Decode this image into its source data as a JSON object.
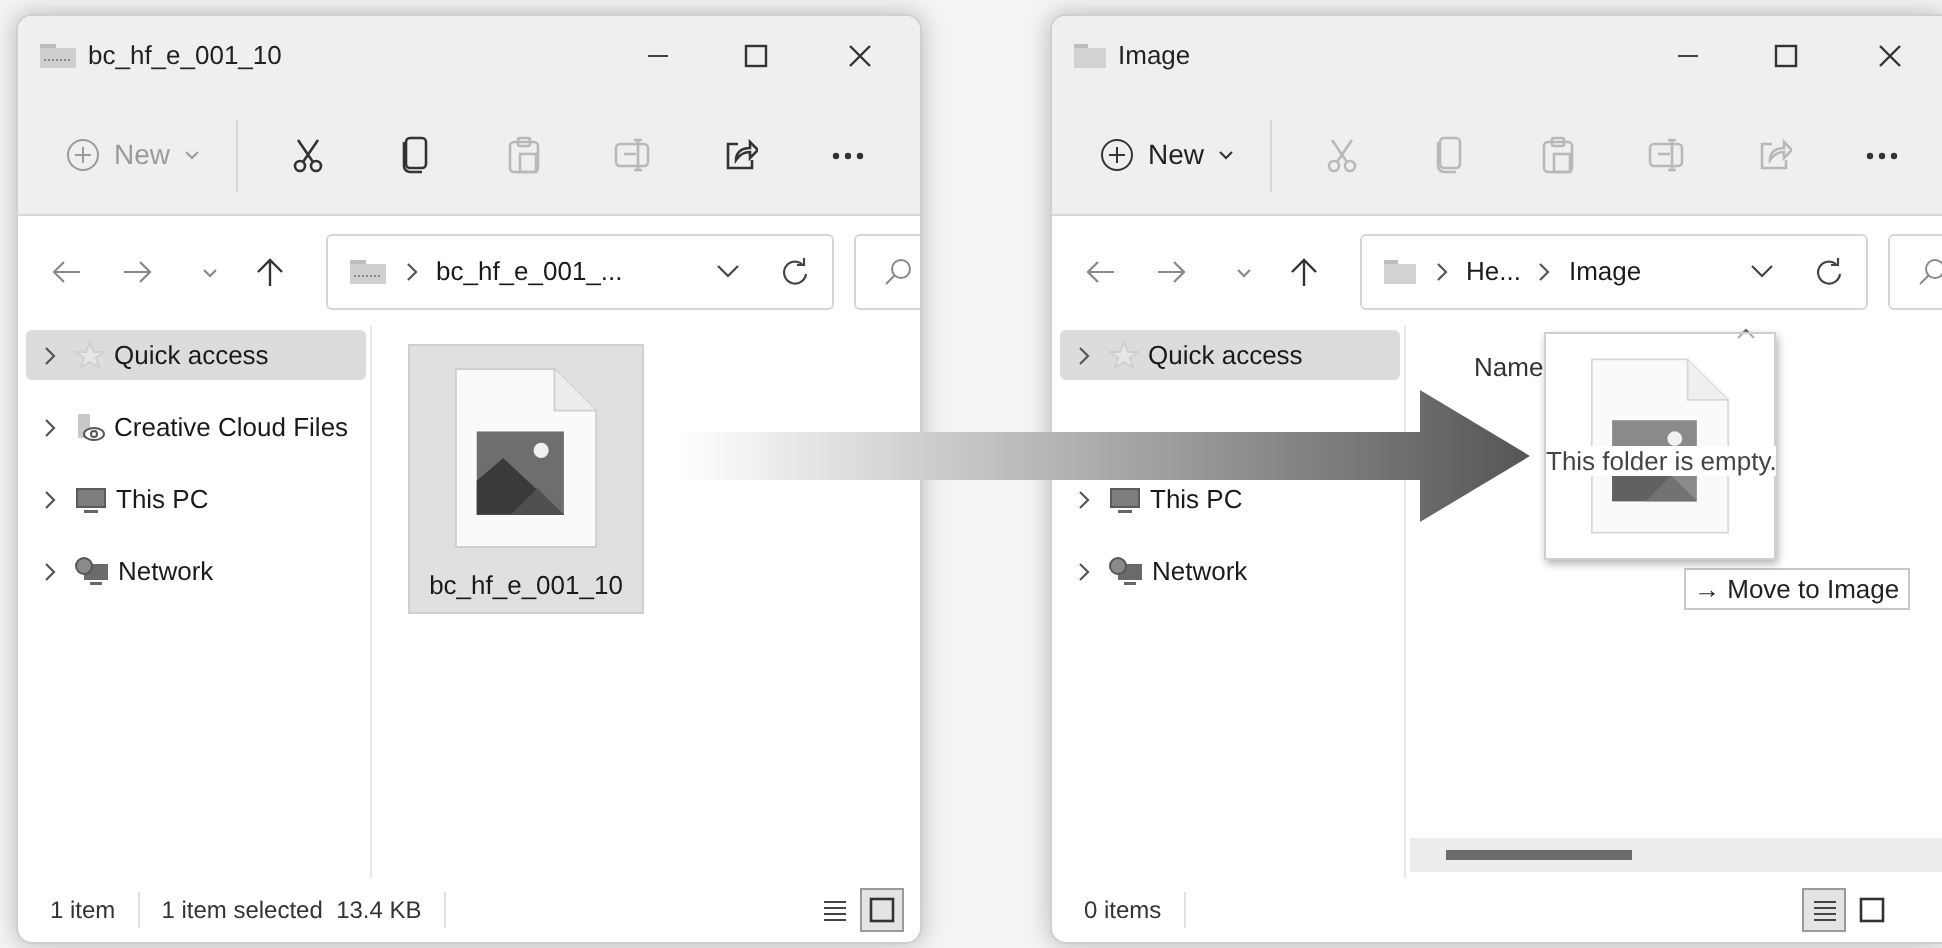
{
  "windows": [
    {
      "title": "bc_hf_e_001_10",
      "toolbar": {
        "new": {
          "label": "New",
          "disabled": true
        },
        "actions": [
          {
            "kind": "cut",
            "disabled": false
          },
          {
            "kind": "copy",
            "disabled": false
          },
          {
            "kind": "paste",
            "disabled": true
          },
          {
            "kind": "rename",
            "disabled": true
          },
          {
            "kind": "share",
            "disabled": false
          },
          {
            "kind": "more",
            "disabled": false
          }
        ]
      },
      "address": {
        "segments": [
          "bc_hf_e_001_..."
        ]
      },
      "sidebar": {
        "items": [
          {
            "label": "Quick access",
            "kind": "star",
            "selected": true
          },
          {
            "label": "Creative Cloud Files",
            "kind": "cloud",
            "selected": false
          },
          {
            "label": "This PC",
            "kind": "pc",
            "selected": false
          },
          {
            "label": "Network",
            "kind": "network",
            "selected": false
          }
        ]
      },
      "content": {
        "files": [
          {
            "name": "bc_hf_e_001_10",
            "selected": true
          }
        ]
      },
      "status": [
        "1 item",
        "1 item selected  13.4 KB"
      ],
      "views": [
        {
          "kind": "details",
          "selected": false
        },
        {
          "kind": "tiles",
          "selected": true
        }
      ]
    },
    {
      "title": "Image",
      "toolbar": {
        "new": {
          "label": "New",
          "disabled": false
        },
        "actions": [
          {
            "kind": "cut",
            "disabled": true
          },
          {
            "kind": "copy",
            "disabled": true
          },
          {
            "kind": "paste",
            "disabled": true
          },
          {
            "kind": "rename",
            "disabled": true
          },
          {
            "kind": "share",
            "disabled": true
          },
          {
            "kind": "more",
            "disabled": false
          }
        ]
      },
      "address": {
        "segments": [
          "He...",
          "Image"
        ]
      },
      "sidebar": {
        "items": [
          {
            "label": "Quick access",
            "kind": "star",
            "selected": true
          },
          {
            "kind": "covered"
          },
          {
            "label": "This PC",
            "kind": "pc",
            "selected": false
          },
          {
            "label": "Network",
            "kind": "network",
            "selected": false
          }
        ]
      },
      "content": {
        "column": "Name",
        "empty_message": "This folder is empty."
      },
      "status": [
        "0 items"
      ],
      "views": [
        {
          "kind": "details",
          "selected": true
        },
        {
          "kind": "tiles",
          "selected": false
        }
      ]
    }
  ],
  "drag": {
    "tooltip": "→ Move to Image"
  }
}
